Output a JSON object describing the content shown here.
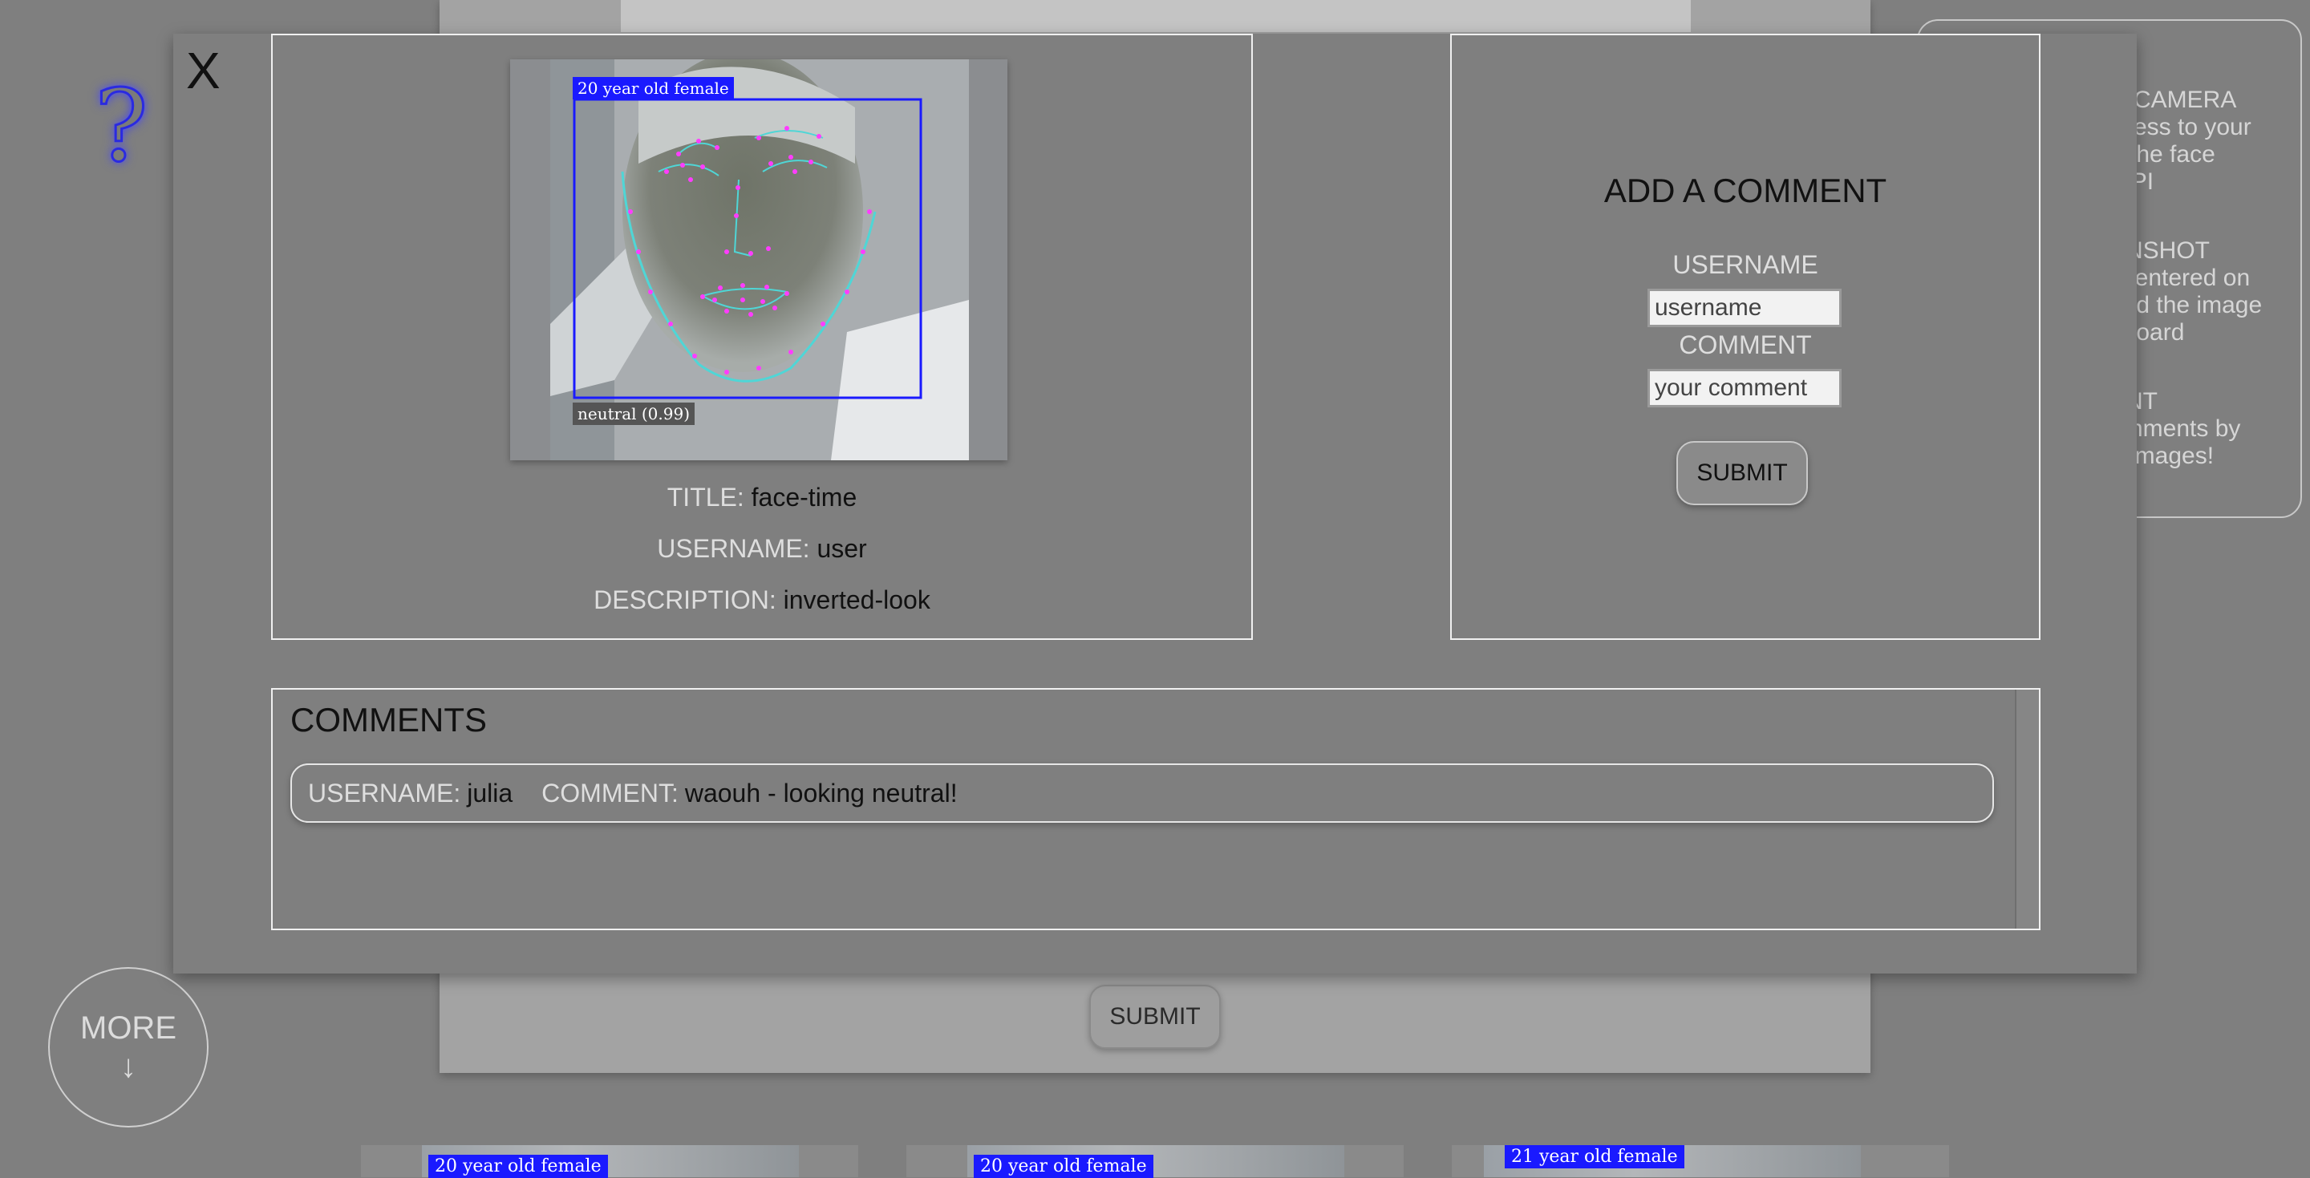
{
  "background": {
    "submit_label": "SUBMIT",
    "more_label": "MORE",
    "more_arrow": "↓",
    "help_icon": "?",
    "help_lines": [
      "R CAMERA\nccess to your\ne the face\n API",
      "ENSHOT\nt centered on\noad the image\neboard",
      "ENT\nomments by\ne images!"
    ],
    "thumb_tags": [
      "20 year old female",
      "20 year old female",
      "21 year old female"
    ]
  },
  "modal": {
    "close_label": "X",
    "photo": {
      "age_tag": "20 year old female",
      "emotion_tag": "neutral (0.99)"
    },
    "meta": {
      "title_key": "TITLE:",
      "title_value": "face-time",
      "username_key": "USERNAME:",
      "username_value": "user",
      "description_key": "DESCRIPTION:",
      "description_value": "inverted-look"
    },
    "form": {
      "title": "ADD A COMMENT",
      "username_label": "USERNAME",
      "username_placeholder": "username",
      "comment_label": "COMMENT",
      "comment_placeholder": "your comment",
      "submit_label": "SUBMIT"
    },
    "comments": {
      "title": "COMMENTS",
      "items": [
        {
          "username_key": "USERNAME:",
          "username": "julia",
          "comment_key": "COMMENT:",
          "comment": "waouh - looking neutral!"
        }
      ]
    }
  },
  "colors": {
    "backdrop": "#7f7f7f",
    "face_box": "#1a1aff",
    "landmarks": "#ff3cff",
    "jawline": "#4fd6d6"
  }
}
